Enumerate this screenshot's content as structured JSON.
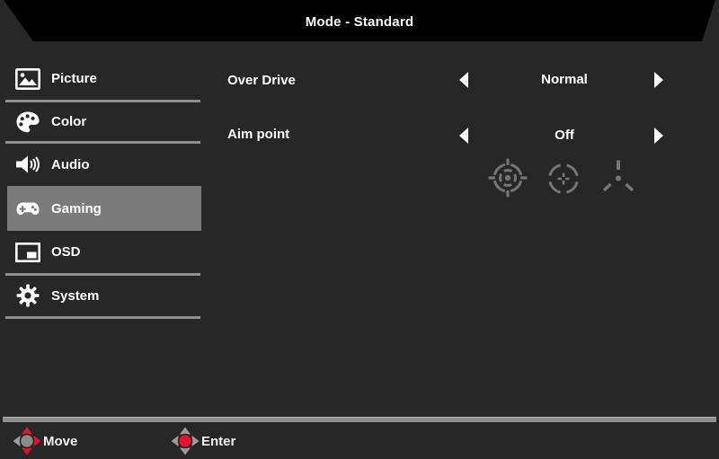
{
  "header": {
    "title": "Mode - Standard"
  },
  "sidebar": {
    "items": [
      {
        "label": "Picture",
        "icon": "picture-icon",
        "selected": false
      },
      {
        "label": "Color",
        "icon": "palette-icon",
        "selected": false
      },
      {
        "label": "Audio",
        "icon": "speaker-icon",
        "selected": false
      },
      {
        "label": "Gaming",
        "icon": "gamepad-icon",
        "selected": true
      },
      {
        "label": "OSD",
        "icon": "osd-window-icon",
        "selected": false
      },
      {
        "label": "System",
        "icon": "gear-icon",
        "selected": false
      }
    ]
  },
  "settings": [
    {
      "label": "Over Drive",
      "value": "Normal"
    },
    {
      "label": "Aim point",
      "value": "Off"
    }
  ],
  "aim_point_previews": [
    "target-dual-ring-icon",
    "target-circle-cross-icon",
    "target-tripod-icon"
  ],
  "footer": [
    {
      "label": "Move",
      "icon": "dpad-move-icon"
    },
    {
      "label": "Enter",
      "icon": "dpad-enter-icon"
    }
  ],
  "colors": {
    "background": "#272727",
    "header_bg": "#000000",
    "text": "#ffffff",
    "selected_item_bg": "#7a7a7a",
    "divider": "#8f8f8f",
    "accent_red": "#e8112d",
    "aim_icon_gray": "#757575"
  }
}
